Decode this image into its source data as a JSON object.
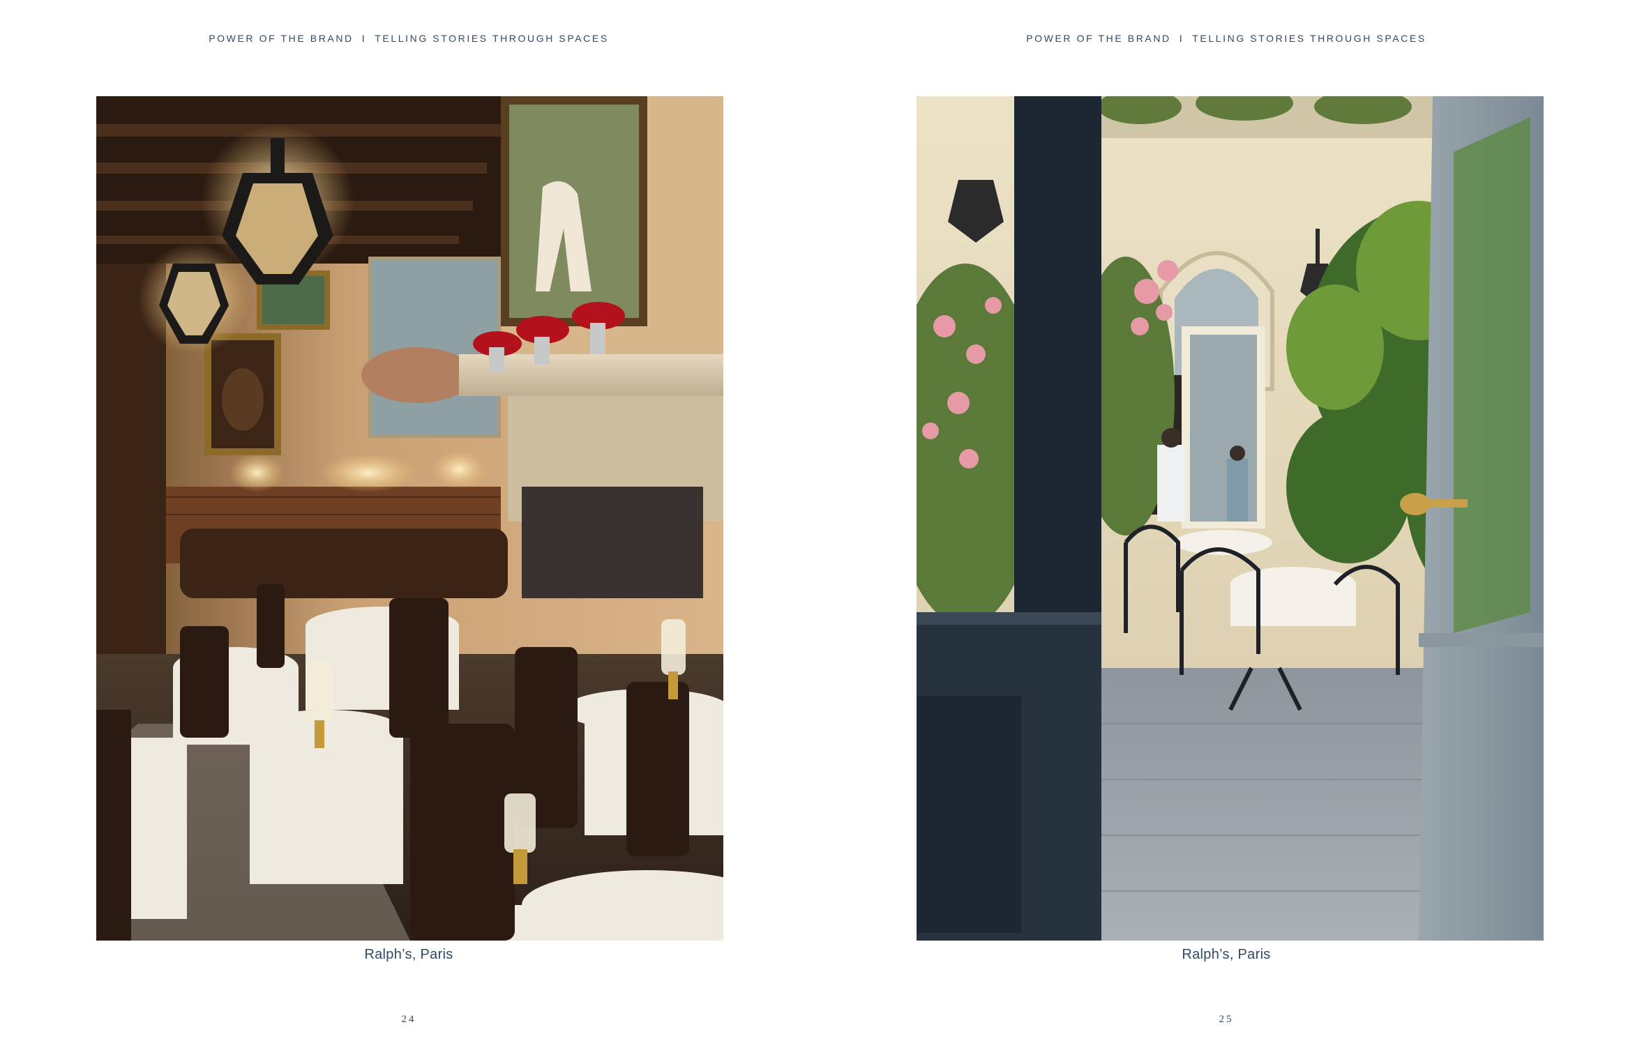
{
  "spread": {
    "left_page": {
      "running_header": {
        "section": "POWER OF THE BRAND",
        "separator": "I",
        "chapter": "TELLING STORIES THROUGH SPACES"
      },
      "photo": {
        "subject": "restaurant-dining-room"
      },
      "caption": "Ralph’s, Paris",
      "folio": "24"
    },
    "right_page": {
      "running_header": {
        "section": "POWER OF THE BRAND",
        "separator": "I",
        "chapter": "TELLING STORIES THROUGH SPACES"
      },
      "photo": {
        "subject": "courtyard-terrace"
      },
      "caption": "Ralph’s, Paris",
      "folio": "25"
    }
  },
  "colors": {
    "text": "#2e4a66",
    "paper": "#ffffff"
  }
}
